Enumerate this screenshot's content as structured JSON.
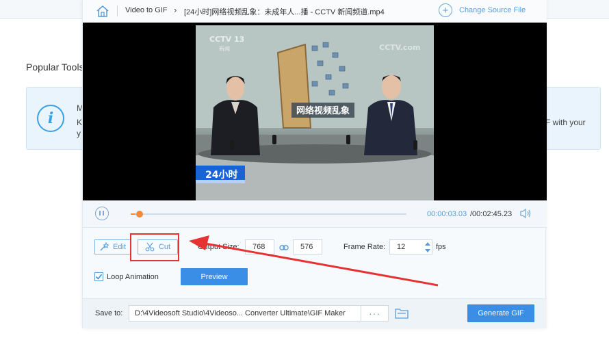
{
  "background": {
    "popular_tools": "Popular Tools",
    "info_line1_prefix": "M",
    "info_line2_prefix": "K",
    "info_line3_prefix": "y",
    "info_line2_suffix": "F with your"
  },
  "header": {
    "breadcrumb_root": "Video to GIF",
    "breadcrumb_file": "[24小时]网络视频乱象：未成年人...播 - CCTV 新闻频道.mp4",
    "change_source": "Change Source File"
  },
  "video": {
    "channel_logo": "CCTV 13",
    "channel_sub": "新闻",
    "watermark": "CCTV.com",
    "banner": "网络视频乱象",
    "program_tag": "24小时"
  },
  "playback": {
    "current_time": "00:00:03.03",
    "total_time": "/00:02:45.23",
    "progress_fraction": 0.018
  },
  "settings": {
    "edit_label": "Edit",
    "cut_label": "Cut",
    "output_size_label": "Output Size:",
    "width_value": "768",
    "height_value": "576",
    "frame_rate_label": "Frame Rate:",
    "frame_rate_value": "12",
    "fps_label": "fps",
    "loop_label": "Loop Animation",
    "loop_checked": true,
    "preview_label": "Preview"
  },
  "footer": {
    "save_to_label": "Save to:",
    "save_path": "D:\\4Videosoft Studio\\4Videoso... Converter Ultimate\\GIF Maker",
    "browse_label": "···",
    "generate_label": "Generate GIF"
  },
  "colors": {
    "accent": "#3b8ee5",
    "link": "#5a9bd6",
    "progress": "#f28a3c",
    "annotation": "#e63232"
  }
}
